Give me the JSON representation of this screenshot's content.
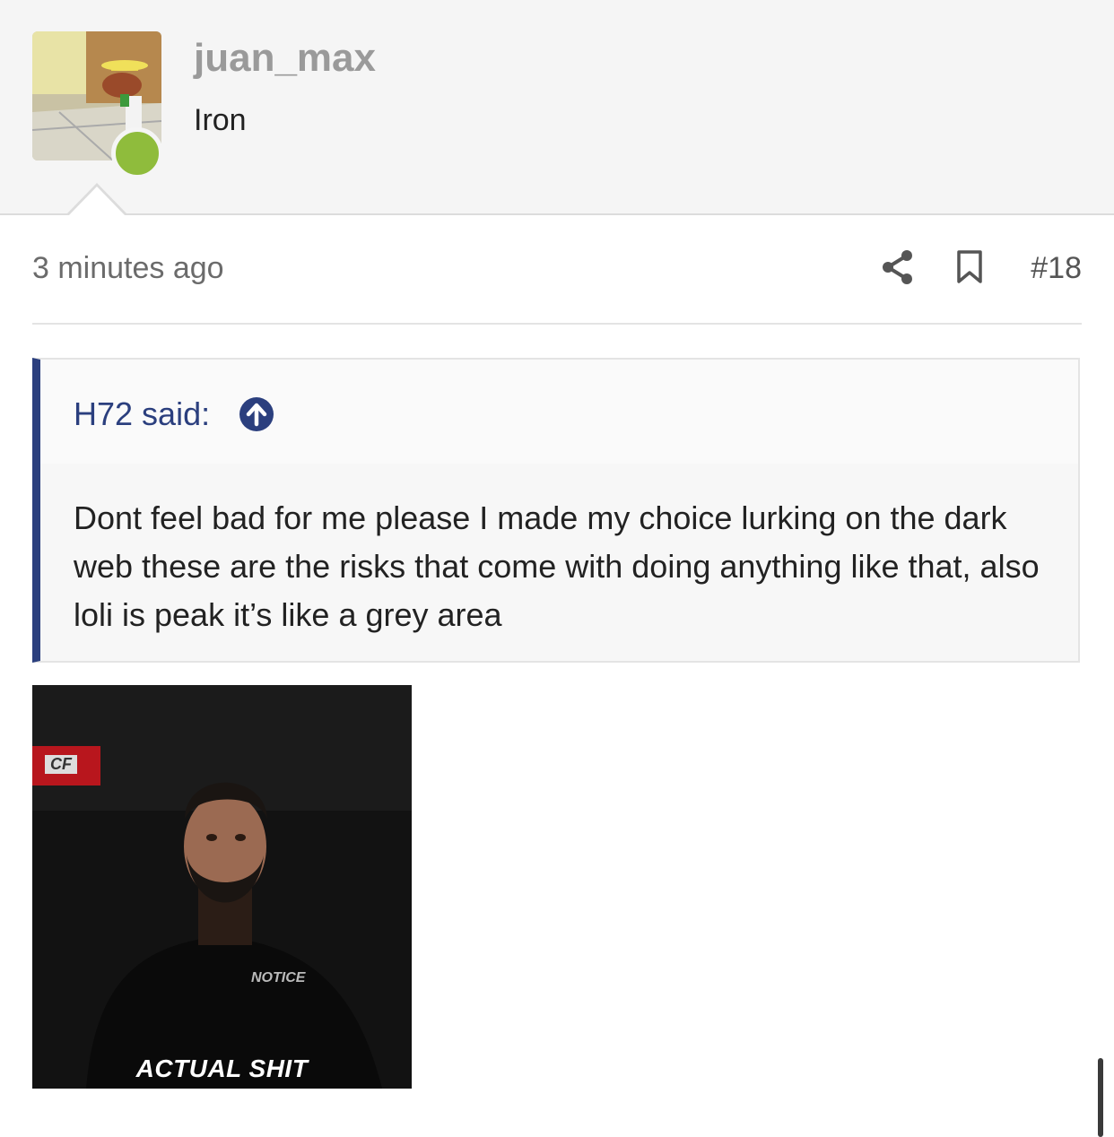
{
  "user": {
    "username": "juan_max",
    "title": "Iron",
    "avatar_icon": "speedy-gonzales-avatar",
    "online_status_color": "#8fbc3c"
  },
  "post": {
    "timestamp": "3 minutes ago",
    "share_icon": "share-icon",
    "bookmark_icon": "bookmark-icon",
    "number": "#18"
  },
  "quote": {
    "author_label": "H72 said:",
    "jump_icon": "arrow-up-circle-icon",
    "body": "Dont feel bad for me please I made my choice lurking on the dark web these are the risks that come with doing anything like that, also loli is peak it’s like a grey area",
    "accent_color": "#2b3f7e"
  },
  "gif": {
    "caption": "ACTUAL SHIT",
    "logo_text": "CF",
    "shirt_text": "NOTICE"
  }
}
